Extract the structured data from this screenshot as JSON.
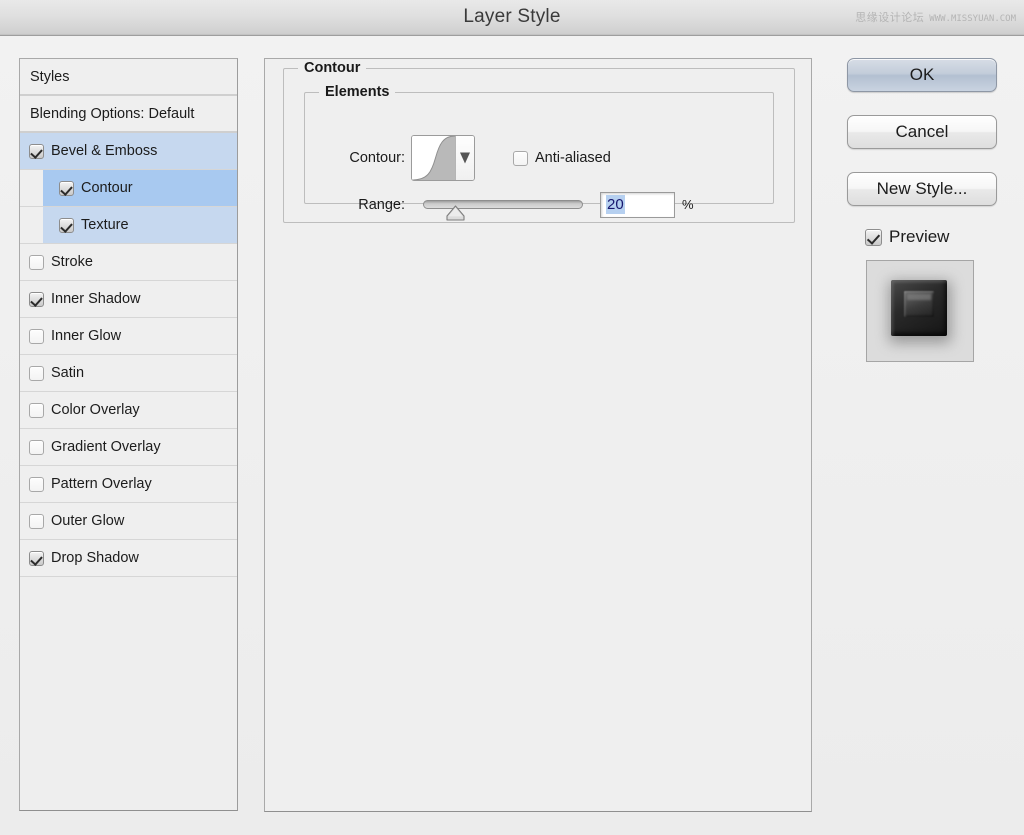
{
  "window": {
    "title": "Layer Style",
    "watermark_cn": "思缘设计论坛",
    "watermark_url": "WWW.MISSYUAN.COM"
  },
  "sidebar": {
    "styles_label": "Styles",
    "blending_label": "Blending Options: Default",
    "effects": [
      {
        "label": "Bevel & Emboss",
        "checked": true,
        "selected": true,
        "sub": false
      },
      {
        "label": "Contour",
        "checked": true,
        "selected": true,
        "sub": true
      },
      {
        "label": "Texture",
        "checked": true,
        "selected": false,
        "sub": true
      },
      {
        "label": "Stroke",
        "checked": false,
        "selected": false,
        "sub": false
      },
      {
        "label": "Inner Shadow",
        "checked": true,
        "selected": false,
        "sub": false
      },
      {
        "label": "Inner Glow",
        "checked": false,
        "selected": false,
        "sub": false
      },
      {
        "label": "Satin",
        "checked": false,
        "selected": false,
        "sub": false
      },
      {
        "label": "Color Overlay",
        "checked": false,
        "selected": false,
        "sub": false
      },
      {
        "label": "Gradient Overlay",
        "checked": false,
        "selected": false,
        "sub": false
      },
      {
        "label": "Pattern Overlay",
        "checked": false,
        "selected": false,
        "sub": false
      },
      {
        "label": "Outer Glow",
        "checked": false,
        "selected": false,
        "sub": false
      },
      {
        "label": "Drop Shadow",
        "checked": true,
        "selected": false,
        "sub": false
      }
    ]
  },
  "main": {
    "group_title": "Contour",
    "elements_title": "Elements",
    "contour_label": "Contour:",
    "contour_preset": "cone-inverted-curve",
    "antialiased_label": "Anti-aliased",
    "antialiased_checked": false,
    "range_label": "Range:",
    "range_value": "20",
    "range_unit": "%",
    "range_min": 0,
    "range_max": 100
  },
  "buttons": {
    "ok": "OK",
    "cancel": "Cancel",
    "new_style": "New Style...",
    "preview_label": "Preview",
    "preview_checked": true
  },
  "colors": {
    "selection_parent": "#c6d8ef",
    "selection_active": "#a8c9f0",
    "field_text": "#15147a",
    "text_selection": "#b6d0f0",
    "panel_bg": "#efefef",
    "window_bg": "#ececec"
  }
}
